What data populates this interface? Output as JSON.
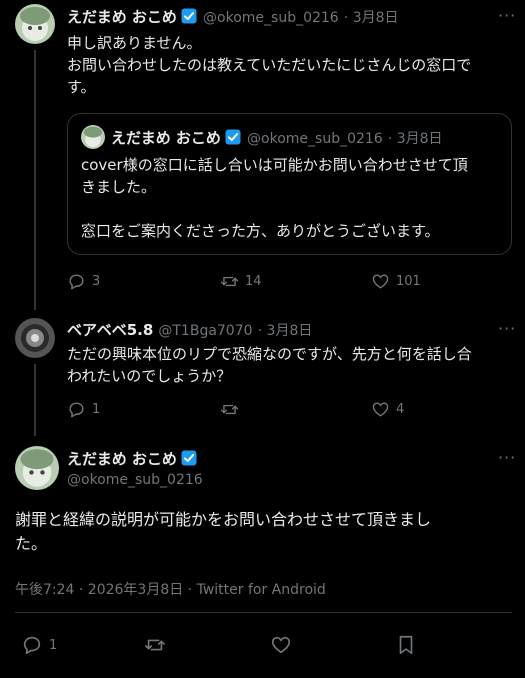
{
  "tweet1": {
    "name": "えだまめ おこめ",
    "handle": "@okome_sub_0216",
    "date": "· 3月8日",
    "text_line1": "申し訳ありません。",
    "text_line2": "お問い合わせしたのは教えていただいたにじさんじの窓口で",
    "text_line3": "す。",
    "quote": {
      "name": "えだまめ おこめ",
      "handle": "@okome_sub_0216",
      "date": "· 3月8日",
      "line1": "cover様の窓口に話し合いは可能かお問い合わせさせて頂",
      "line2": "きました。",
      "line3": "窓口をご案内くださった方、ありがとうございます。"
    },
    "replies": "3",
    "retweets": "14",
    "likes": "101"
  },
  "tweet2": {
    "name": "ベアベベ5.8",
    "handle": "@T1Bga7070",
    "date": "· 3月8日",
    "text_line1": "ただの興味本位のリプで恐縮なのですが、先方と何を話し合",
    "text_line2": "われたいのでしょうか？",
    "replies": "1",
    "likes": "4"
  },
  "main": {
    "name": "えだまめ おこめ",
    "handle": "@okome_sub_0216",
    "text_line1": "謝罪と経緯の説明が可能かをお問い合わせさせて頂きまし",
    "text_line2": "た。",
    "meta": "午後7:24 · 2026年3月8日 · Twitter for Android",
    "replies": "1"
  },
  "more_label": "···",
  "colors": {
    "background": "#000000",
    "text": "#e7e9ea",
    "muted": "#71767b",
    "verified": "#1d9bf0",
    "divider": "#2f3336"
  }
}
